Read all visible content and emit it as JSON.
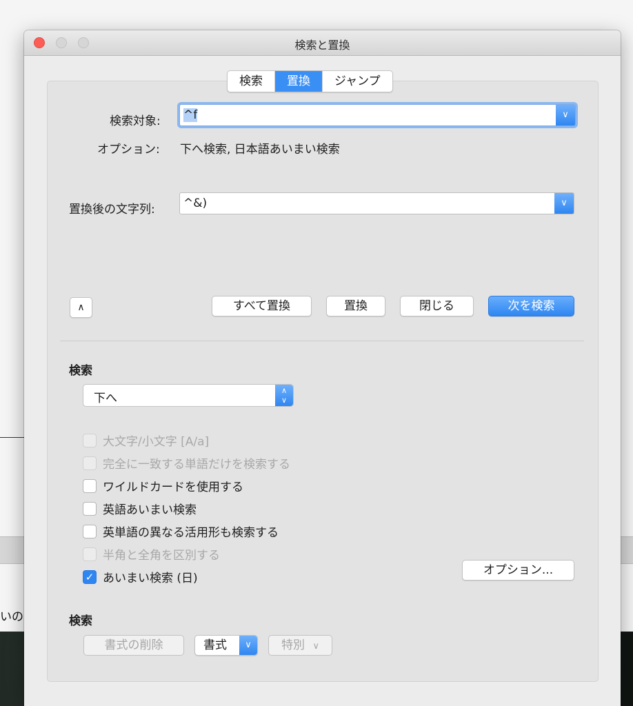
{
  "window": {
    "title": "検索と置換"
  },
  "tabs": [
    {
      "label": "検索",
      "active": false
    },
    {
      "label": "置換",
      "active": true
    },
    {
      "label": "ジャンプ",
      "active": false
    }
  ],
  "search": {
    "label": "検索対象:",
    "value": "^f"
  },
  "options": {
    "label": "オプション:",
    "value": "下へ検索, 日本語あいまい検索"
  },
  "replace": {
    "label": "置換後の文字列:",
    "value": "^&)"
  },
  "buttons": {
    "replace_all": "すべて置換",
    "replace": "置換",
    "close": "閉じる",
    "find_next": "次を検索",
    "options": "オプション..."
  },
  "search_section": {
    "heading": "検索",
    "direction": "下へ"
  },
  "checkboxes": [
    {
      "label": "大文字/小文字 [A/a]",
      "checked": false,
      "enabled": false
    },
    {
      "label": "完全に一致する単語だけを検索する",
      "checked": false,
      "enabled": false
    },
    {
      "label": "ワイルドカードを使用する",
      "checked": false,
      "enabled": true
    },
    {
      "label": "英語あいまい検索",
      "checked": false,
      "enabled": true
    },
    {
      "label": "英単語の異なる活用形も検索する",
      "checked": false,
      "enabled": true
    },
    {
      "label": "半角と全角を区別する",
      "checked": false,
      "enabled": false
    },
    {
      "label": "あいまい検索 (日)",
      "checked": true,
      "enabled": true
    }
  ],
  "format_section": {
    "heading": "検索",
    "clear_format": "書式の削除",
    "format": "書式",
    "special": "特別"
  },
  "background": {
    "fragment_text": "いので"
  },
  "colors": {
    "accent": "#2f86f1",
    "close_button": "#fc5e56"
  }
}
